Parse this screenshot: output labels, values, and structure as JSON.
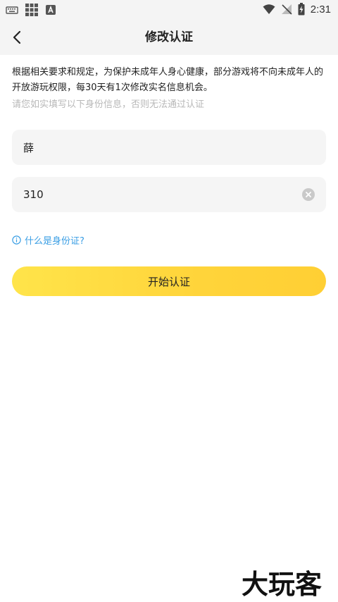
{
  "status_bar": {
    "time": "2:31",
    "icons": [
      "keyboard-icon",
      "grid-icon",
      "app-a-icon",
      "wifi-icon",
      "no-signal-icon",
      "battery-charging-icon"
    ]
  },
  "header": {
    "title": "修改认证"
  },
  "notice": {
    "text": "根据相关要求和规定，为保护未成年人身心健康，部分游戏将不向未成年人的开放游玩权限，每30天有1次修改实名信息机会。",
    "hint": "请您如实填写以下身份信息，否则无法通过认证"
  },
  "form": {
    "name_value": "薛",
    "id_value": "310"
  },
  "id_link": {
    "label": "什么是身份证?"
  },
  "start_button": {
    "label": "开始认证"
  },
  "watermark": {
    "text": "大玩客"
  },
  "colors": {
    "accent_yellow": "#ffd83e",
    "link_blue": "#3a9ee4",
    "hint_gray": "#b8b8b8",
    "input_bg": "#f5f5f5"
  }
}
